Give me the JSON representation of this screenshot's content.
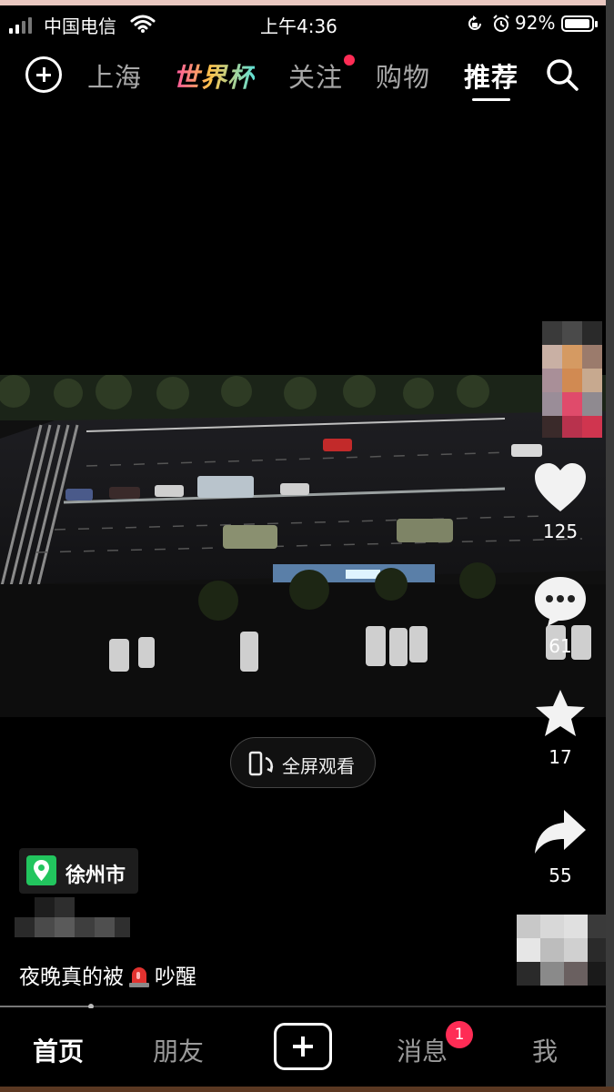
{
  "status_bar": {
    "carrier": "中国电信",
    "time": "上午4:36",
    "battery_percent": "92%",
    "battery_level": 0.92
  },
  "top_nav": {
    "tabs": [
      "上海",
      "世界杯",
      "关注",
      "购物",
      "推荐"
    ],
    "active_tab": "推荐",
    "follow_has_dot": true
  },
  "video": {
    "fullscreen_label": "全屏观看",
    "location": "徐州市",
    "caption_before": "夜晚真的被",
    "caption_after": "吵醒",
    "caption_emoji": "siren-icon",
    "progress": 0.15
  },
  "actions": {
    "likes": "125",
    "comments": "61",
    "favorites": "17",
    "shares": "55"
  },
  "bottom_nav": {
    "home": "首页",
    "friends": "朋友",
    "messages": "消息",
    "me": "我",
    "messages_badge": "1"
  },
  "colors": {
    "accent_red": "#ff2c55",
    "location_green": "#22c55e"
  }
}
